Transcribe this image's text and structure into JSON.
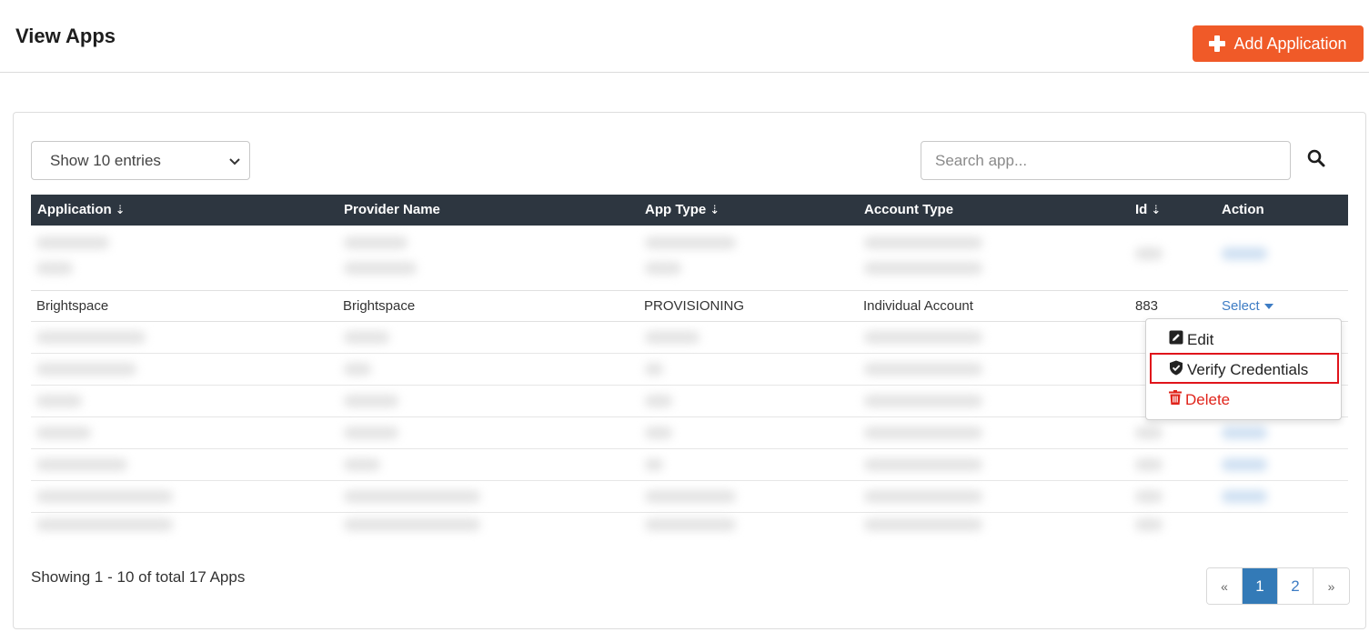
{
  "header": {
    "title": "View Apps",
    "add_button_label": "Add Application"
  },
  "toolbar": {
    "entries_label": "Show 10 entries",
    "search_placeholder": "Search app..."
  },
  "table": {
    "columns": [
      "Application",
      "Provider Name",
      "App Type",
      "Account Type",
      "Id",
      "Action"
    ],
    "visible_row": {
      "application": "Brightspace",
      "provider_name": "Brightspace",
      "app_type": "PROVISIONING",
      "account_type": "Individual Account",
      "id": "883",
      "action": "Select"
    }
  },
  "action_menu": {
    "items": [
      "Edit",
      "Verify Credentials",
      "Delete"
    ]
  },
  "footer": {
    "info": "Showing 1 - 10 of total 17 Apps"
  },
  "pagination": {
    "prev": "«",
    "pages": [
      "1",
      "2"
    ],
    "next": "»",
    "current": "1"
  },
  "colors": {
    "accent": "#f05a28",
    "header_bg": "#2d3640",
    "link": "#3d7cc4",
    "danger": "#e0241b",
    "active_page": "#337ab7"
  },
  "icons": [
    "plus-icon",
    "search-icon",
    "sort-icon",
    "chevron-down-icon",
    "edit-icon",
    "shield-check-icon",
    "trash-icon",
    "caret-down-icon"
  ]
}
